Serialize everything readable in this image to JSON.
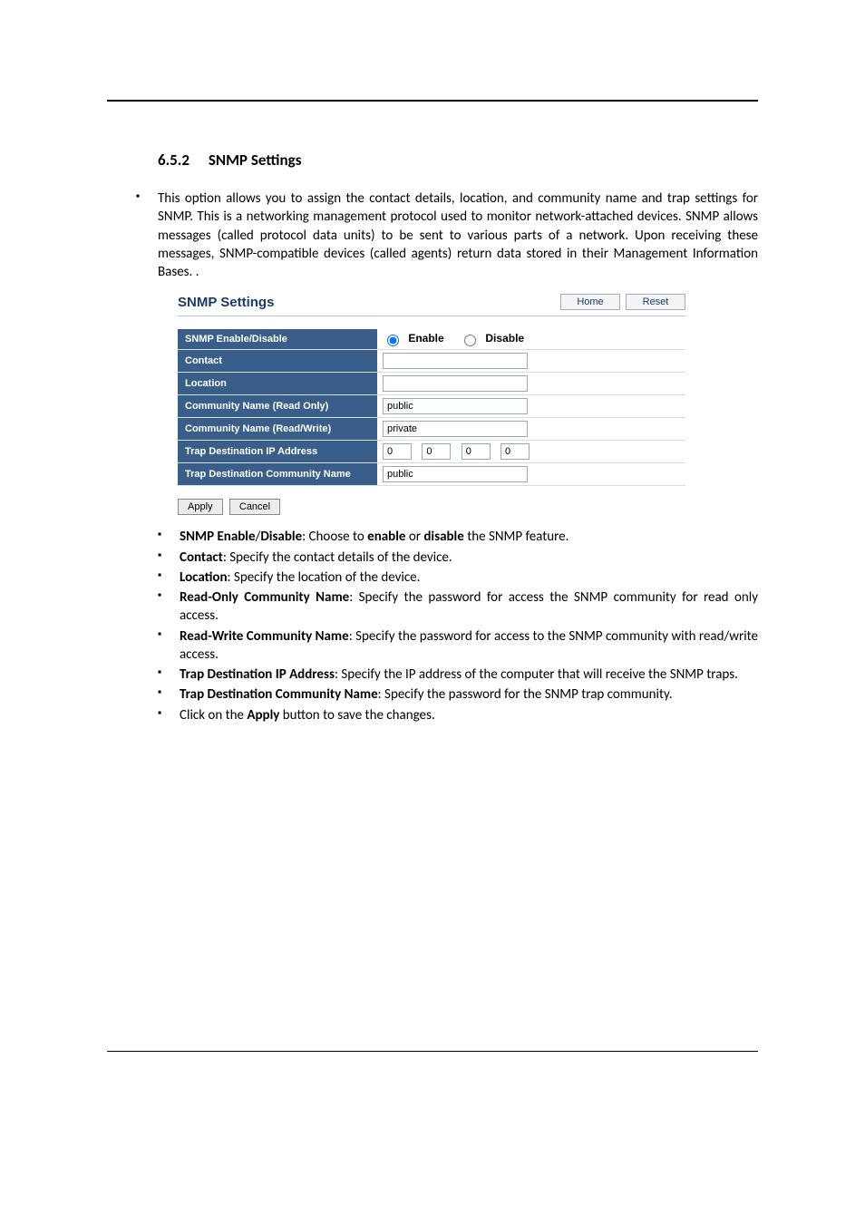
{
  "section": {
    "number": "6.5.2",
    "title": "SNMP Settings"
  },
  "intro": "This option allows you to assign the contact details, location, and community name and trap settings for SNMP. This is a networking management protocol used to monitor network-attached devices. SNMP allows messages (called protocol data units) to be sent to various parts of a network. Upon receiving these messages, SNMP-compatible devices (called agents) return data stored in their Management Information Bases. .",
  "panel": {
    "title": "SNMP Settings",
    "home": "Home",
    "reset": "Reset",
    "rows": {
      "enable_label": "SNMP Enable/Disable",
      "enable_opt": "Enable",
      "disable_opt": "Disable",
      "contact_label": "Contact",
      "contact_value": "",
      "location_label": "Location",
      "location_value": "",
      "ro_label": "Community Name (Read Only)",
      "ro_value": "public",
      "rw_label": "Community Name (Read/Write)",
      "rw_value": "private",
      "trapip_label": "Trap Destination IP Address",
      "trapip": {
        "a": "0",
        "b": "0",
        "c": "0",
        "d": "0"
      },
      "trapcn_label": "Trap Destination Community Name",
      "trapcn_value": "public"
    },
    "apply": "Apply",
    "cancel": "Cancel"
  },
  "bullets": {
    "b1a": "SNMP Enable",
    "b1slash": "/",
    "b1b": "Disable",
    "b1c": ": Choose to ",
    "b1d": "enable",
    "b1e": " or ",
    "b1f": "disable",
    "b1g": " the SNMP feature.",
    "b2a": "Contact",
    "b2b": ": Specify the contact details of the device.",
    "b3a": "Location",
    "b3b": ": Specify the location of the device.",
    "b4a": "Read-Only Community Name",
    "b4b": ": Specify the password for access the SNMP community for read only access.",
    "b5a": "Read-Write Community Name",
    "b5b": ": Specify the password for access to the SNMP community with read/write access.",
    "b6a": "Trap Destination IP Address",
    "b6b": ": Specify the IP address of the computer that will receive the SNMP traps.",
    "b7a": "Trap Destination Community Name",
    "b7b": ": Specify the password for the SNMP trap community.",
    "b8a": "Click on the ",
    "b8b": "Apply",
    "b8c": " button to save the changes."
  }
}
